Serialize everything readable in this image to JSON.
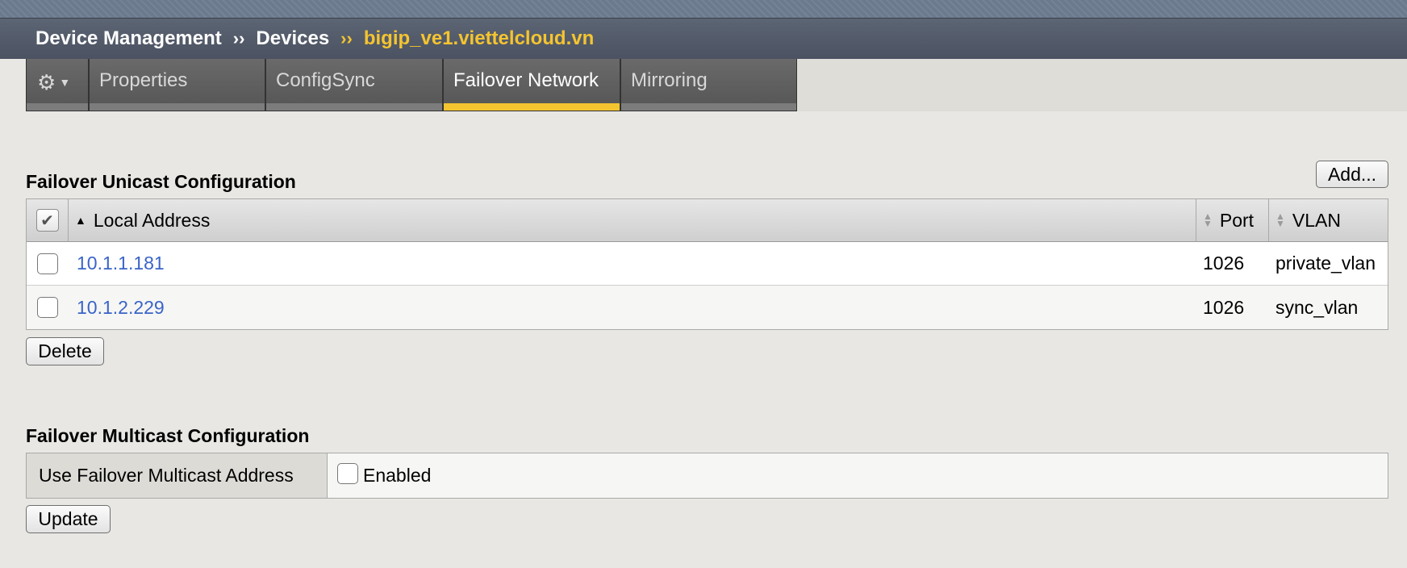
{
  "breadcrumb": {
    "items": [
      "Device Management",
      "Devices"
    ],
    "separator": "››",
    "current": "bigip_ve1.viettelcloud.vn"
  },
  "tabs": {
    "gear_icon": "gear-icon",
    "items": [
      "Properties",
      "ConfigSync",
      "Failover Network",
      "Mirroring"
    ],
    "active": "Failover Network"
  },
  "unicast": {
    "title": "Failover Unicast Configuration",
    "add_label": "Add...",
    "columns": [
      "Local Address",
      "Port",
      "VLAN"
    ],
    "rows": [
      {
        "address": "10.1.1.181",
        "port": "1026",
        "vlan": "private_vlan"
      },
      {
        "address": "10.1.2.229",
        "port": "1026",
        "vlan": "sync_vlan"
      }
    ],
    "delete_label": "Delete"
  },
  "multicast": {
    "title": "Failover Multicast Configuration",
    "field_label": "Use Failover Multicast Address",
    "checkbox_label": "Enabled",
    "enabled": false,
    "update_label": "Update"
  },
  "colors": {
    "accent": "#f4c430",
    "link": "#3a64c8",
    "titlebar": "#545b69"
  }
}
